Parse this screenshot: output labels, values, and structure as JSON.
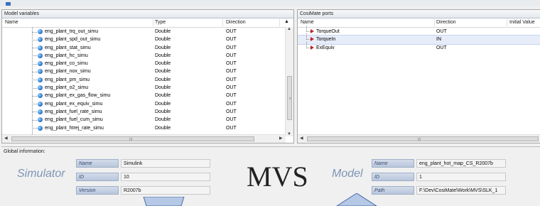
{
  "left_panel": {
    "title": "Model variables",
    "columns": [
      "Name",
      "Type",
      "Direction"
    ],
    "rows": [
      {
        "name": "eng_plant_trq_out_simu",
        "type": "Double",
        "direction": "OUT"
      },
      {
        "name": "eng_plant_spd_out_simu",
        "type": "Double",
        "direction": "OUT"
      },
      {
        "name": "eng_plant_stat_simu",
        "type": "Double",
        "direction": "OUT"
      },
      {
        "name": "eng_plant_hc_simu",
        "type": "Double",
        "direction": "OUT"
      },
      {
        "name": "eng_plant_co_simu",
        "type": "Double",
        "direction": "OUT"
      },
      {
        "name": "eng_plant_nox_simu",
        "type": "Double",
        "direction": "OUT"
      },
      {
        "name": "eng_plant_pm_simu",
        "type": "Double",
        "direction": "OUT"
      },
      {
        "name": "eng_plant_o2_simu",
        "type": "Double",
        "direction": "OUT"
      },
      {
        "name": "eng_plant_ex_gas_flow_simu",
        "type": "Double",
        "direction": "OUT"
      },
      {
        "name": "eng_plant_ex_equiv_simu",
        "type": "Double",
        "direction": "OUT"
      },
      {
        "name": "eng_plant_fuel_rate_simu",
        "type": "Double",
        "direction": "OUT"
      },
      {
        "name": "eng_plant_fuel_cum_simu",
        "type": "Double",
        "direction": "OUT"
      },
      {
        "name": "eng_plant_htrej_rate_simu",
        "type": "Double",
        "direction": "OUT"
      }
    ],
    "hscroll_grip": "III",
    "vscroll_grip": "≡"
  },
  "right_panel": {
    "title": "CosiMate ports",
    "columns": [
      "Name",
      "Direction",
      "Initial Value"
    ],
    "rows": [
      {
        "name": "TorqueOut",
        "direction": "OUT",
        "selected": false
      },
      {
        "name": "TorqueIn",
        "direction": "IN",
        "selected": true
      },
      {
        "name": "ExEquiv",
        "direction": "OUT",
        "selected": false
      }
    ],
    "hscroll_grip": "III"
  },
  "global": {
    "label": "Global information:",
    "simulator": {
      "heading": "Simulator",
      "fields": [
        {
          "label": "Name",
          "value": "Simulink"
        },
        {
          "label": "ID",
          "value": "10"
        },
        {
          "label": "Version",
          "value": "R2007b"
        }
      ]
    },
    "center_logo": "MVS",
    "model": {
      "heading": "Model",
      "fields": [
        {
          "label": "Name",
          "value": "eng_plant_hot_map_CS_R2007b"
        },
        {
          "label": "ID",
          "value": "1"
        },
        {
          "label": "Path",
          "value": "F:\\Dev\\CosiMate\\Work\\MVS\\SLK_1"
        }
      ]
    }
  },
  "colors": {
    "accent": "#3a6fc2",
    "port_arrow": "#c0232b",
    "heading_blue": "#7d95b4",
    "variable_icon": "#2a7bd0"
  },
  "icons": {
    "variable": "globe-icon",
    "port": "arrow-port-icon"
  }
}
